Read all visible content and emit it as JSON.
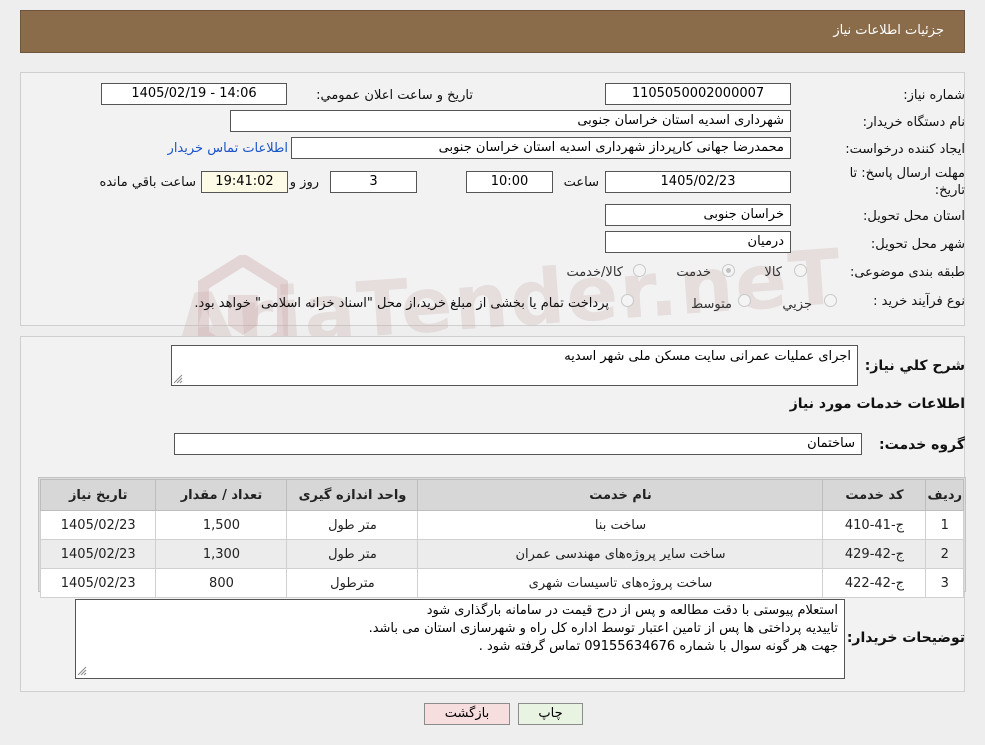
{
  "header": {
    "title": "جزئیات اطلاعات نیاز"
  },
  "info": {
    "need_number_label": "شماره نیاز:",
    "need_number": "1105050002000007",
    "announce_label": "تاریخ و ساعت اعلان عمومي:",
    "announce_value": "1405/02/19 - 14:06",
    "buyer_org_label": "نام دستگاه خريدار:",
    "buyer_org": "شهرداری اسدیه استان خراسان جنوبی",
    "creator_label": "ايجاد كننده درخواست:",
    "creator": "محمدرضا جهانی کارپرداز شهرداری اسدیه استان خراسان جنوبی",
    "contact_link": "اطلاعات تماس خريدار",
    "deadline_label_1": "مهلت ارسال پاسخ: تا",
    "deadline_label_2": "تاريخ:",
    "deadline_date": "1405/02/23",
    "hour_label": "ساعت",
    "deadline_time": "10:00",
    "days_value": "3",
    "days_label": "روز و",
    "remaining_time": "19:41:02",
    "remaining_label": "ساعت باقي مانده",
    "province_label": "استان محل تحويل:",
    "province": "خراسان جنوبی",
    "city_label": "شهر محل تحويل:",
    "city": "درمیان",
    "category_label": "طبقه بندی موضوعی:",
    "category_options": [
      "کالا",
      "خدمت",
      "کالا/خدمت"
    ],
    "category_selected": 1,
    "process_label": "نوع فرآيند خريد :",
    "process_options": [
      "جزيي",
      "متوسط"
    ],
    "process_note": "پرداخت تمام یا بخشی از مبلغ خرید،از محل \"اسناد خزانه اسلامی\" خواهد بود."
  },
  "details": {
    "summary_label": "شرح كلي نياز:",
    "summary": "اجرای عملیات  عمرانی سایت مسکن ملی شهر اسدیه",
    "services_title": "اطلاعات خدمات مورد نياز",
    "service_group_label": "گروه خدمت:",
    "service_group": "ساختمان",
    "table": {
      "headers": [
        "رديف",
        "كد خدمت",
        "نام خدمت",
        "واحد اندازه گيری",
        "تعداد / مقدار",
        "تاريخ نياز"
      ],
      "rows": [
        [
          "1",
          "ج-41-410",
          "ساخت بنا",
          "متر طول",
          "1,500",
          "1405/02/23"
        ],
        [
          "2",
          "ج-42-429",
          "ساخت سایر پروژه‌های مهندسی عمران",
          "متر طول",
          "1,300",
          "1405/02/23"
        ],
        [
          "3",
          "ج-42-422",
          "ساخت پروژه‌های تاسیسات شهری",
          "مترطول",
          "800",
          "1405/02/23"
        ]
      ]
    },
    "buyer_notes_label": "توضيحات خريدار:",
    "buyer_notes": [
      "استعلام پیوستی با دقت مطالعه و پس از درج قیمت در سامانه بارگذاری شود",
      "تاییدیه پرداختی ها پس از تامین اعتبار توسط اداره کل راه و شهرسازی استان  می باشد.",
      "جهت هر گونه سوال با شماره 09155634676 تماس گرفته شود ."
    ]
  },
  "buttons": {
    "print": "چاپ",
    "back": "بازگشت"
  },
  "watermark": {
    "text": "AriaTender.neT"
  },
  "colors": {
    "header_bg": "#8a6b4a",
    "link": "#1a55c8"
  }
}
